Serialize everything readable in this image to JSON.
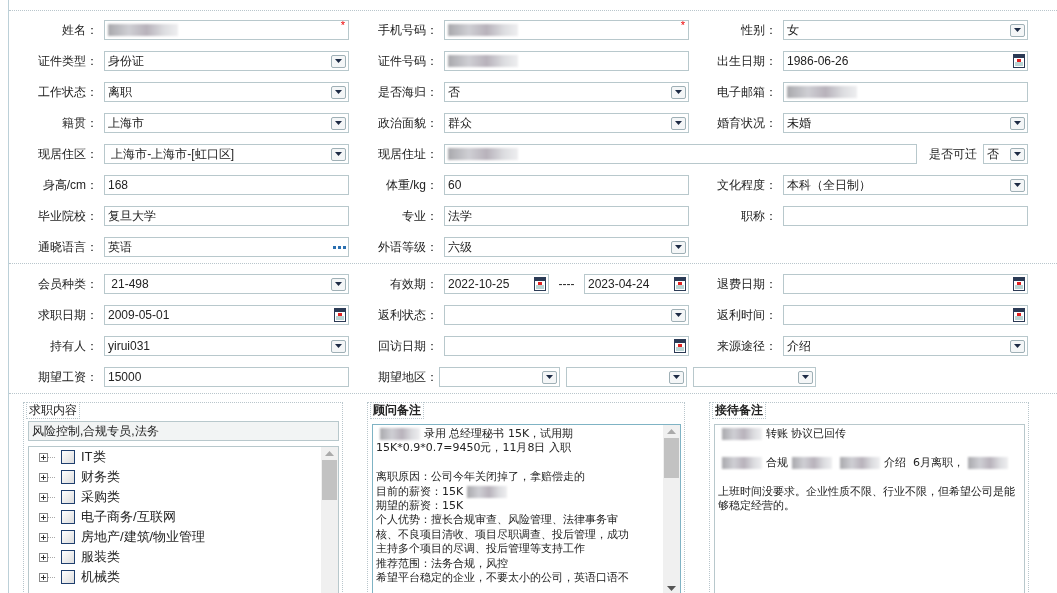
{
  "profile": {
    "rows": [
      [
        {
          "label": "姓名：",
          "kind": "text",
          "redacted": true,
          "required_mark": "*"
        },
        {
          "label": "手机号码：",
          "kind": "text",
          "redacted": true,
          "required_mark": "*"
        },
        {
          "label": "性别：",
          "kind": "select",
          "value": "女"
        }
      ],
      [
        {
          "label": "证件类型：",
          "kind": "select",
          "value": "身份证"
        },
        {
          "label": "证件号码：",
          "kind": "text",
          "redacted": true
        },
        {
          "label": "出生日期：",
          "kind": "date",
          "value": "1986-06-26"
        }
      ],
      [
        {
          "label": "工作状态：",
          "kind": "select",
          "value": "离职"
        },
        {
          "label": "是否海归：",
          "kind": "select",
          "value": "否"
        },
        {
          "label": "电子邮箱：",
          "kind": "text",
          "redacted": true
        }
      ],
      [
        {
          "label": "籍贯：",
          "kind": "select",
          "value": "上海市"
        },
        {
          "label": "政治面貌：",
          "kind": "select",
          "value": "群众"
        },
        {
          "label": "婚育状况：",
          "kind": "select",
          "value": "未婚"
        }
      ],
      [
        {
          "label": "现居住区：",
          "kind": "select",
          "value": " 上海市-上海市-[虹口区]"
        },
        {
          "label": "现居住址：",
          "kind": "text",
          "redacted": true,
          "wide": true,
          "extra": {
            "label": "是否可迁",
            "kind": "select",
            "value": "否"
          }
        }
      ],
      [
        {
          "label": "身高/cm：",
          "kind": "text",
          "value": "168"
        },
        {
          "label": "体重/kg：",
          "kind": "text",
          "value": "60"
        },
        {
          "label": "文化程度：",
          "kind": "select",
          "value": "本科（全日制）"
        }
      ],
      [
        {
          "label": "毕业院校：",
          "kind": "text",
          "value": "复旦大学"
        },
        {
          "label": "专业：",
          "kind": "text",
          "value": "法学"
        },
        {
          "label": "职称：",
          "kind": "text"
        }
      ],
      [
        {
          "label": "通晓语言：",
          "kind": "lookup",
          "value": "英语"
        },
        {
          "label": "外语等级：",
          "kind": "select",
          "value": "六级"
        }
      ]
    ]
  },
  "membership": {
    "rows": [
      [
        {
          "label": "会员种类：",
          "kind": "select",
          "value": " 21-498"
        },
        {
          "label": "有效期：",
          "kind": "date_range",
          "from": "2022-10-25",
          "separator": "----",
          "to": "2023-04-24"
        },
        {
          "label": "退费日期：",
          "kind": "date"
        }
      ],
      [
        {
          "label": "求职日期：",
          "kind": "date",
          "value": "2009-05-01"
        },
        {
          "label": "返利状态：",
          "kind": "select"
        },
        {
          "label": "返利时间：",
          "kind": "date"
        }
      ],
      [
        {
          "label": "持有人：",
          "kind": "select",
          "value": "yirui031"
        },
        {
          "label": "回访日期：",
          "kind": "date"
        },
        {
          "label": "来源途径：",
          "kind": "select",
          "value": "介绍"
        }
      ],
      [
        {
          "label": "期望工资：",
          "kind": "text",
          "value": "15000"
        },
        {
          "label": "期望地区：",
          "kind": "select_group",
          "selects": [
            {
              "kind": "select"
            },
            {
              "kind": "select"
            },
            {
              "kind": "select"
            }
          ]
        }
      ]
    ]
  },
  "job_wanted": {
    "legend": "求职内容",
    "summary": "风险控制,合规专员,法务",
    "categories": [
      {
        "label": "IT类",
        "expanded": false,
        "checked": false
      },
      {
        "label": "财务类",
        "expanded": false,
        "checked": false
      },
      {
        "label": "采购类",
        "expanded": false,
        "checked": false
      },
      {
        "label": "电子商务/互联网",
        "expanded": false,
        "checked": false
      },
      {
        "label": "房地产/建筑/物业管理",
        "expanded": false,
        "checked": false
      },
      {
        "label": "服装类",
        "expanded": false,
        "checked": false
      },
      {
        "label": "机械类",
        "expanded": false,
        "checked": false
      }
    ]
  },
  "consultant_notes": {
    "legend": "顾问备注",
    "lines": [
      {
        "kind": "text",
        "segments": [
          {
            "kind": "blur"
          },
          {
            "kind": "text",
            "text": "录用 总经理秘书 15K，试用期"
          }
        ]
      },
      {
        "kind": "text",
        "segments": [
          {
            "kind": "text",
            "text": "15K*0.9*0.7=9450元，11月8日 入职"
          }
        ]
      },
      {
        "kind": "gap"
      },
      {
        "kind": "text",
        "segments": [
          {
            "kind": "text",
            "text": "离职原因：公司今年关闭掉了，拿赔偿走的"
          }
        ]
      },
      {
        "kind": "text",
        "segments": [
          {
            "kind": "text",
            "text": "目前的薪资：15K"
          },
          {
            "kind": "blur"
          }
        ]
      },
      {
        "kind": "text",
        "segments": [
          {
            "kind": "text",
            "text": "期望的薪资：15K"
          }
        ]
      },
      {
        "kind": "text",
        "segments": [
          {
            "kind": "text",
            "text": "个人优势：擅长合规审查、风险管理、法律事务审"
          }
        ]
      },
      {
        "kind": "text",
        "segments": [
          {
            "kind": "text",
            "text": "核、不良项目清收、项目尽职调查、投后管理，成功"
          }
        ]
      },
      {
        "kind": "text",
        "segments": [
          {
            "kind": "text",
            "text": "主持多个项目的尽调、投后管理等支持工作"
          }
        ]
      },
      {
        "kind": "text",
        "segments": [
          {
            "kind": "text",
            "text": "推荐范围：法务合规，风控"
          }
        ]
      },
      {
        "kind": "text",
        "segments": [
          {
            "kind": "text",
            "text": "希望平台稳定的企业，不要太小的公司，英语口语不"
          }
        ]
      }
    ]
  },
  "reception_notes": {
    "legend": "接待备注",
    "lines": [
      {
        "kind": "text",
        "segments": [
          {
            "kind": "blur"
          },
          {
            "kind": "text",
            "text": "转账 协议已回传"
          }
        ]
      },
      {
        "kind": "gap"
      },
      {
        "kind": "text",
        "segments": [
          {
            "kind": "blur"
          },
          {
            "kind": "text",
            "text": "合规"
          },
          {
            "kind": "blur"
          },
          {
            "kind": "blur"
          },
          {
            "kind": "text",
            "text": "介绍  6月离职，"
          },
          {
            "kind": "blur"
          }
        ]
      },
      {
        "kind": "gap"
      },
      {
        "kind": "text",
        "segments": [
          {
            "kind": "text",
            "text": "上班时间没要求。企业性质不限、行业不限，但希望公司是能够稳定经营的。"
          }
        ]
      }
    ]
  }
}
